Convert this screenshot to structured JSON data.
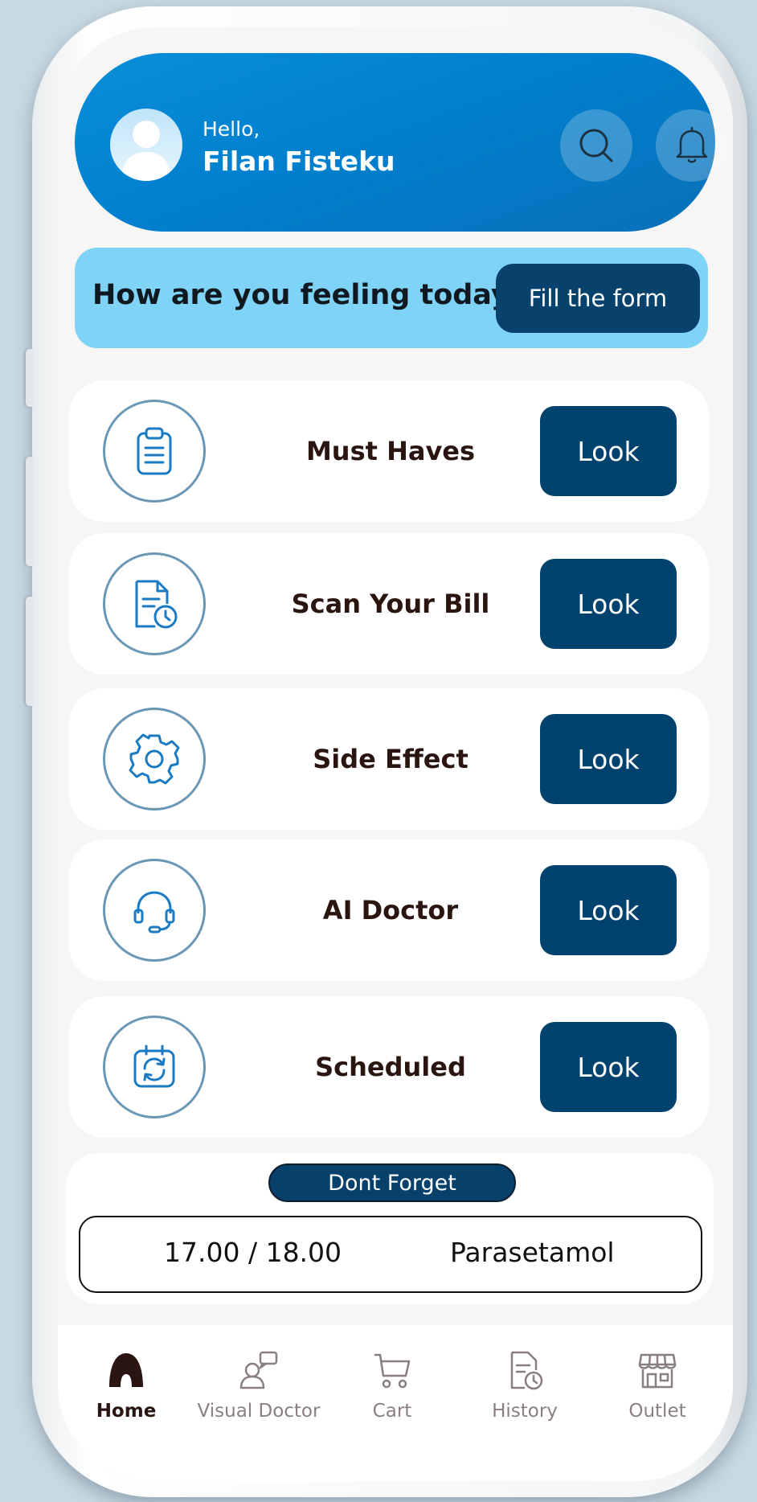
{
  "header": {
    "greeting": "Hello,",
    "user_name": "Filan Fisteku",
    "search_icon": "search-icon",
    "notification_icon": "bell-icon"
  },
  "feeling_banner": {
    "prompt": "How are you feeling today",
    "button_label": "Fill the form"
  },
  "features": [
    {
      "label": "Must Haves",
      "icon": "clipboard-icon",
      "button_label": "Look"
    },
    {
      "label": "Scan Your Bill",
      "icon": "bill-clock-icon",
      "button_label": "Look"
    },
    {
      "label": "Side Effect",
      "icon": "gear-icon",
      "button_label": "Look"
    },
    {
      "label": "AI Doctor",
      "icon": "headset-icon",
      "button_label": "Look"
    },
    {
      "label": "Scheduled",
      "icon": "calendar-sync-icon",
      "button_label": "Look"
    }
  ],
  "reminder": {
    "title": "Dont Forget",
    "time": "17.00 / 18.00",
    "medicine": "Parasetamol"
  },
  "nav": [
    {
      "label": "Home",
      "icon": "home-icon",
      "active": true
    },
    {
      "label": "Visual Doctor",
      "icon": "visual-doctor-icon",
      "active": false
    },
    {
      "label": "Cart",
      "icon": "cart-icon",
      "active": false
    },
    {
      "label": "History",
      "icon": "history-icon",
      "active": false
    },
    {
      "label": "Outlet",
      "icon": "store-icon",
      "active": false
    }
  ],
  "colors": {
    "header_blue": "#0080cf",
    "banner_light_blue": "#7fd3f7",
    "button_dark_blue": "#00426e",
    "icon_outline": "#6b97b6",
    "feature_icon_blue": "#1a7ac2",
    "text_dark": "#2b1510"
  }
}
